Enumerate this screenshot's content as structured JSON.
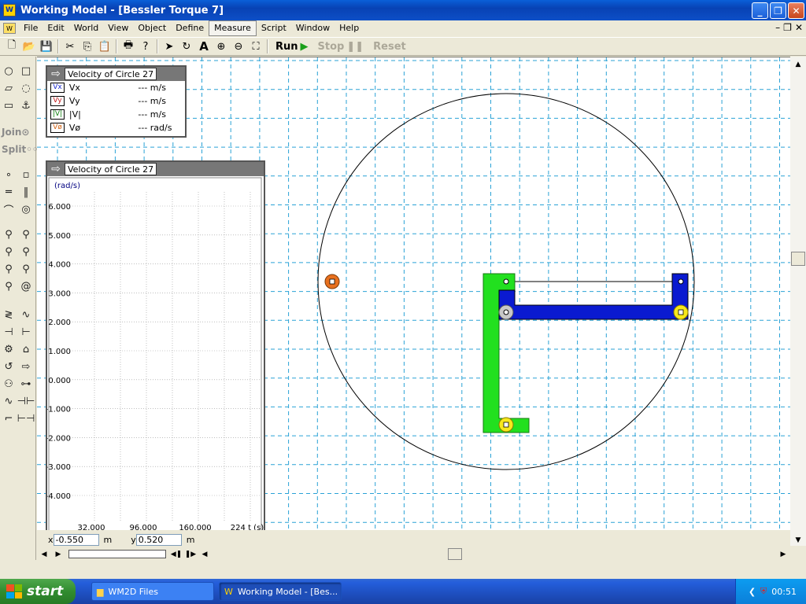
{
  "window": {
    "title": "Working Model - [Bessler Torque 7]"
  },
  "menu": [
    "File",
    "Edit",
    "World",
    "View",
    "Object",
    "Define",
    "Measure",
    "Script",
    "Window",
    "Help"
  ],
  "toolbar": {
    "run": "Run",
    "stop": "Stop",
    "reset": "Reset"
  },
  "palette": {
    "join": "Join",
    "split": "Split"
  },
  "digital_meter": {
    "title": "Velocity of Circle 27",
    "rows": [
      {
        "tag": "Vx",
        "label": "Vx",
        "value": "--- m/s"
      },
      {
        "tag": "Vy",
        "label": "Vy",
        "value": "--- m/s"
      },
      {
        "tag": "|V|",
        "label": "|V|",
        "value": "--- m/s"
      },
      {
        "tag": "Vø",
        "label": "Vø",
        "value": "--- rad/s"
      }
    ]
  },
  "graph_meter": {
    "title": "Velocity of Circle 27",
    "unit": "(rad/s)",
    "y_ticks": [
      "6.000",
      "5.000",
      "4.000",
      "3.000",
      "2.000",
      "1.000",
      "0.000",
      "-1.000",
      "-2.000",
      "-3.000",
      "-4.000"
    ],
    "x_ticks": [
      "32.000",
      "96.000",
      "160.000",
      "224 t (s)"
    ]
  },
  "coords": {
    "x_label": "x",
    "x_value": "-0.550",
    "x_unit": "m",
    "y_label": "y",
    "y_value": "0.520",
    "y_unit": "m"
  },
  "taskbar": {
    "start": "start",
    "tasks": [
      {
        "label": "WM2D Files"
      },
      {
        "label": "Working Model - [Bes..."
      }
    ],
    "clock": "00:51"
  },
  "colors": {
    "green_body": "#22e01f",
    "blue_body": "#0a1ad0",
    "orange_point": "#e8701e",
    "yellow_point": "#f7e81c",
    "grid": "#2aa2d6"
  }
}
